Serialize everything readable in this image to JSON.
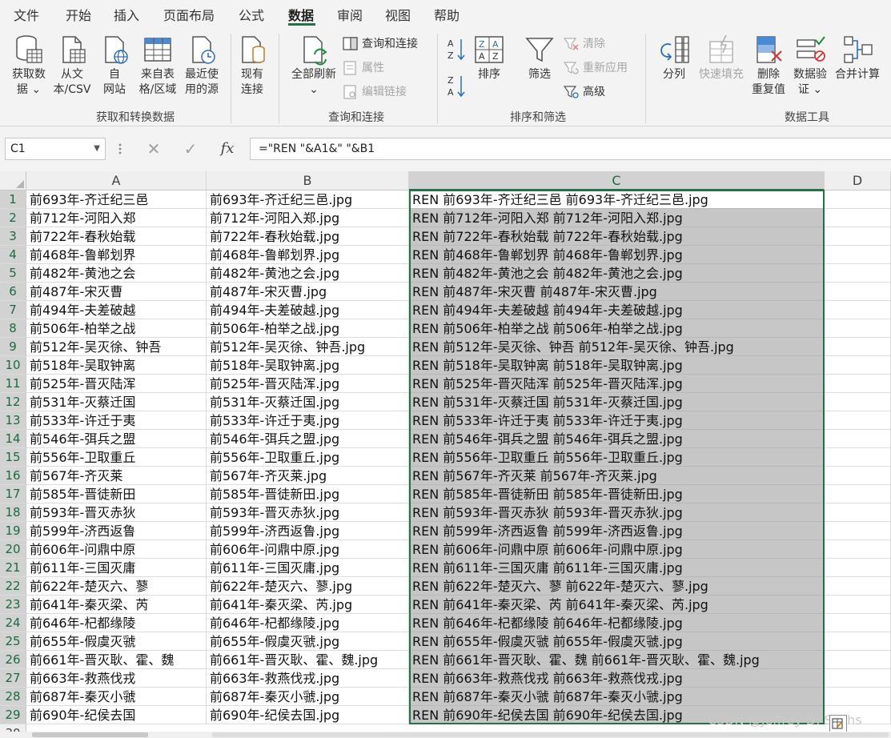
{
  "menu": {
    "tabs": [
      "文件",
      "开始",
      "插入",
      "页面布局",
      "公式",
      "数据",
      "审阅",
      "视图",
      "帮助"
    ],
    "active_index": 5
  },
  "ribbon": {
    "get_data": {
      "line1": "获取数",
      "line2": "据 ⌄"
    },
    "from_text": {
      "line1": "从文",
      "line2": "本/CSV"
    },
    "from_web": {
      "line1": "自",
      "line2": "网站"
    },
    "from_table": {
      "line1": "来自表",
      "line2": "格/区域"
    },
    "recent_sources": {
      "line1": "最近使",
      "line2": "用的源"
    },
    "existing_conn": {
      "line1": "现有",
      "line2": "连接"
    },
    "group_get_transform": "获取和转换数据",
    "refresh_all": {
      "line1": "全部刷新",
      "line2": "⌄"
    },
    "queries_connections": "查询和连接",
    "properties": "属性",
    "edit_links": "编辑链接",
    "group_queries": "查询和连接",
    "sort": "排序",
    "filter": "筛选",
    "clear": "清除",
    "reapply": "重新应用",
    "advanced": "高级",
    "group_sort_filter": "排序和筛选",
    "text_to_columns": "分列",
    "flash_fill": "快速填充",
    "remove_duplicates": {
      "line1": "删除",
      "line2": "重复值"
    },
    "data_validation": {
      "line1": "数据验",
      "line2": "证 ⌄"
    },
    "consolidate": "合并计算",
    "group_data_tools": "数据工具"
  },
  "formula_bar": {
    "name_box": "C1",
    "formula": "=\"REN \"&A1&\" \"&B1",
    "fx": "fx"
  },
  "columns": [
    "A",
    "B",
    "C",
    "D"
  ],
  "selected_column": "C",
  "rows": [
    {
      "n": "1",
      "a": "前693年-齐迁纪三邑",
      "b": "前693年-齐迁纪三邑.jpg",
      "c": "REN 前693年-齐迁纪三邑 前693年-齐迁纪三邑.jpg"
    },
    {
      "n": "2",
      "a": "前712年-河阳入郑",
      "b": "前712年-河阳入郑.jpg",
      "c": "REN 前712年-河阳入郑 前712年-河阳入郑.jpg"
    },
    {
      "n": "3",
      "a": "前722年-春秋始载",
      "b": "前722年-春秋始载.jpg",
      "c": "REN 前722年-春秋始载 前722年-春秋始载.jpg"
    },
    {
      "n": "4",
      "a": "前468年-鲁郸划界",
      "b": "前468年-鲁郸划界.jpg",
      "c": "REN 前468年-鲁郸划界 前468年-鲁郸划界.jpg"
    },
    {
      "n": "5",
      "a": "前482年-黄池之会",
      "b": "前482年-黄池之会.jpg",
      "c": "REN 前482年-黄池之会 前482年-黄池之会.jpg"
    },
    {
      "n": "6",
      "a": "前487年-宋灭曹",
      "b": "前487年-宋灭曹.jpg",
      "c": "REN 前487年-宋灭曹 前487年-宋灭曹.jpg"
    },
    {
      "n": "7",
      "a": "前494年-夫差破越",
      "b": "前494年-夫差破越.jpg",
      "c": "REN 前494年-夫差破越 前494年-夫差破越.jpg"
    },
    {
      "n": "8",
      "a": "前506年-柏举之战",
      "b": "前506年-柏举之战.jpg",
      "c": "REN 前506年-柏举之战 前506年-柏举之战.jpg"
    },
    {
      "n": "9",
      "a": "前512年-吴灭徐、钟吾",
      "b": "前512年-吴灭徐、钟吾.jpg",
      "c": "REN 前512年-吴灭徐、钟吾 前512年-吴灭徐、钟吾.jpg"
    },
    {
      "n": "10",
      "a": "前518年-吴取钟离",
      "b": "前518年-吴取钟离.jpg",
      "c": "REN 前518年-吴取钟离 前518年-吴取钟离.jpg"
    },
    {
      "n": "11",
      "a": "前525年-晋灭陆浑",
      "b": "前525年-晋灭陆浑.jpg",
      "c": "REN 前525年-晋灭陆浑 前525年-晋灭陆浑.jpg"
    },
    {
      "n": "12",
      "a": "前531年-灭蔡迁国",
      "b": "前531年-灭蔡迁国.jpg",
      "c": "REN 前531年-灭蔡迁国 前531年-灭蔡迁国.jpg"
    },
    {
      "n": "13",
      "a": "前533年-许迁于夷",
      "b": "前533年-许迁于夷.jpg",
      "c": "REN 前533年-许迁于夷 前533年-许迁于夷.jpg"
    },
    {
      "n": "14",
      "a": "前546年-弭兵之盟",
      "b": "前546年-弭兵之盟.jpg",
      "c": "REN 前546年-弭兵之盟 前546年-弭兵之盟.jpg"
    },
    {
      "n": "15",
      "a": "前556年-卫取重丘",
      "b": "前556年-卫取重丘.jpg",
      "c": "REN 前556年-卫取重丘 前556年-卫取重丘.jpg"
    },
    {
      "n": "16",
      "a": "前567年-齐灭莱",
      "b": "前567年-齐灭莱.jpg",
      "c": "REN 前567年-齐灭莱 前567年-齐灭莱.jpg"
    },
    {
      "n": "17",
      "a": "前585年-晋徒新田",
      "b": "前585年-晋徒新田.jpg",
      "c": "REN 前585年-晋徒新田 前585年-晋徒新田.jpg"
    },
    {
      "n": "18",
      "a": "前593年-晋灭赤狄",
      "b": "前593年-晋灭赤狄.jpg",
      "c": "REN 前593年-晋灭赤狄 前593年-晋灭赤狄.jpg"
    },
    {
      "n": "19",
      "a": "前599年-济西返鲁",
      "b": "前599年-济西返鲁.jpg",
      "c": "REN 前599年-济西返鲁 前599年-济西返鲁.jpg"
    },
    {
      "n": "20",
      "a": "前606年-问鼎中原",
      "b": "前606年-问鼎中原.jpg",
      "c": "REN 前606年-问鼎中原 前606年-问鼎中原.jpg"
    },
    {
      "n": "21",
      "a": "前611年-三国灭庸",
      "b": "前611年-三国灭庸.jpg",
      "c": "REN 前611年-三国灭庸 前611年-三国灭庸.jpg"
    },
    {
      "n": "22",
      "a": "前622年-楚灭六、蓼",
      "b": "前622年-楚灭六、蓼.jpg",
      "c": "REN 前622年-楚灭六、蓼 前622年-楚灭六、蓼.jpg"
    },
    {
      "n": "23",
      "a": "前641年-秦灭梁、芮",
      "b": "前641年-秦灭梁、芮.jpg",
      "c": "REN 前641年-秦灭梁、芮 前641年-秦灭梁、芮.jpg"
    },
    {
      "n": "24",
      "a": "前646年-杞都缘陵",
      "b": "前646年-杞都缘陵.jpg",
      "c": "REN 前646年-杞都缘陵 前646年-杞都缘陵.jpg"
    },
    {
      "n": "25",
      "a": "前655年-假虞灭虢",
      "b": "前655年-假虞灭虢.jpg",
      "c": "REN 前655年-假虞灭虢 前655年-假虞灭虢.jpg"
    },
    {
      "n": "26",
      "a": "前661年-晋灭耿、霍、魏",
      "b": "前661年-晋灭耿、霍、魏.jpg",
      "c": "REN 前661年-晋灭耿、霍、魏 前661年-晋灭耿、霍、魏.jpg"
    },
    {
      "n": "27",
      "a": "前663年-救燕伐戎",
      "b": "前663年-救燕伐戎.jpg",
      "c": "REN 前663年-救燕伐戎 前663年-救燕伐戎.jpg"
    },
    {
      "n": "28",
      "a": "前687年-秦灭小虢",
      "b": "前687年-秦灭小虢.jpg",
      "c": "REN 前687年-秦灭小虢 前687年-秦灭小虢.jpg"
    },
    {
      "n": "29",
      "a": "前690年-纪侯去国",
      "b": "前690年-纪侯去国.jpg",
      "c": "REN 前690年-纪侯去国 前690年-纪侯去国.jpg"
    }
  ],
  "partial_row": "30",
  "watermark": "CSDN @Jeffrey D. Sachs"
}
